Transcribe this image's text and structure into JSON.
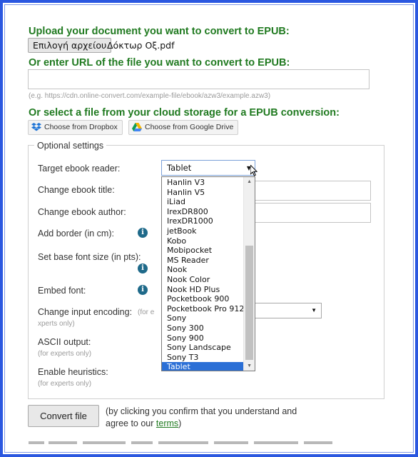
{
  "upload": {
    "heading": "Upload your document you want to convert to EPUB:",
    "file_button": "Επιλογή αρχείου",
    "file_name": "Δόκτωρ Οξ.pdf"
  },
  "url": {
    "heading": "Or enter URL of the file you want to convert to EPUB:",
    "value": "",
    "hint": "(e.g. https://cdn.online-convert.com/example-file/ebook/azw3/example.azw3)"
  },
  "cloud": {
    "heading": "Or select a file from your cloud storage for a EPUB conversion:",
    "dropbox_label": "Choose from Dropbox",
    "gdrive_label": "Choose from Google Drive"
  },
  "settings": {
    "legend": "Optional settings",
    "target_reader_label": "Target ebook reader:",
    "target_reader_value": "Tablet",
    "title_label": "Change ebook title:",
    "author_label": "Change ebook author:",
    "border_label": "Add border (in cm):",
    "font_size_label": "Set base font size (in pts):",
    "embed_label": "Embed font:",
    "encoding_label": "Change input encoding:",
    "encoding_note_a": "(for e",
    "encoding_note_b": "xperts only)",
    "ascii_label": "ASCII output:",
    "ascii_note": "(for experts only)",
    "heuristics_label": "Enable heuristics:",
    "heuristics_note": "(for experts only)"
  },
  "dropdown": {
    "options": [
      "Hanlin V3",
      "Hanlin V5",
      "iLiad",
      "IrexDR800",
      "IrexDR1000",
      "jetBook",
      "Kobo",
      "Mobipocket",
      "MS Reader",
      "Nook",
      "Nook Color",
      "Nook HD Plus",
      "Pocketbook 900",
      "Pocketbook Pro 912",
      "Sony",
      "Sony 300",
      "Sony 900",
      "Sony Landscape",
      "Sony T3",
      "Tablet"
    ],
    "selected": "Tablet"
  },
  "submit": {
    "button": "Convert file",
    "confirm_text": "(by clicking you confirm that you understand and agree to our ",
    "terms_link": "terms",
    "confirm_end": ")"
  },
  "colors": {
    "heading_green": "#207a20",
    "frame_blue": "#2a57e0",
    "selected_blue": "#2b6fd6",
    "info_teal": "#1f6a8a"
  }
}
